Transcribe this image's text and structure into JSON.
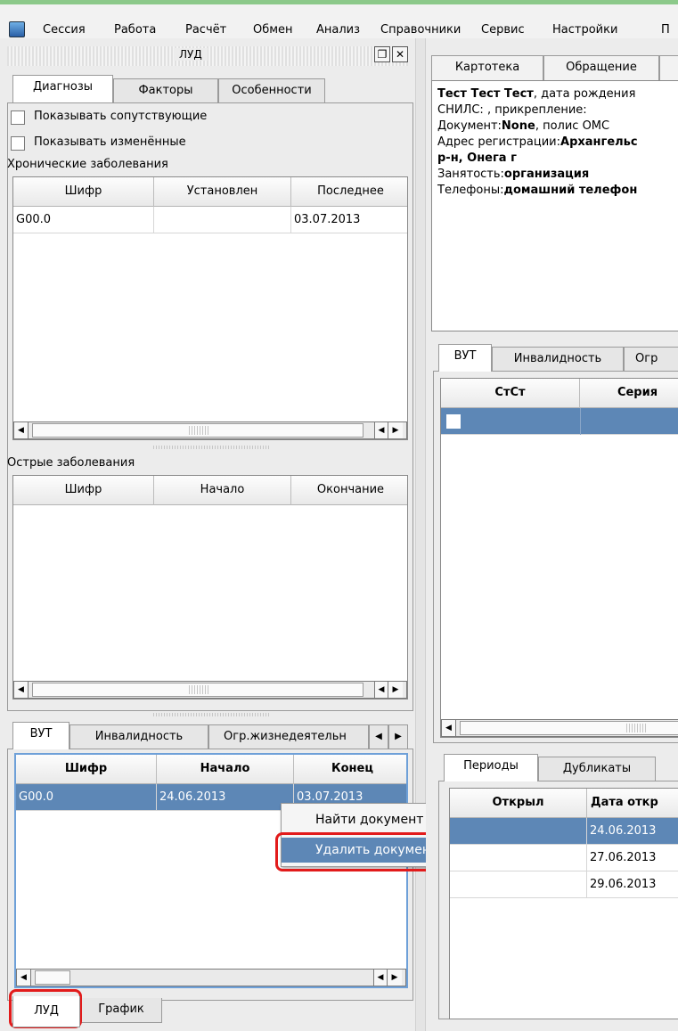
{
  "menu": [
    "Сессия",
    "Работа",
    "Расчёт",
    "Обмен",
    "Анализ",
    "Справочники",
    "Сервис",
    "Настройки",
    "П"
  ],
  "dock": {
    "title": "ЛУД",
    "float_icon": "float-icon",
    "close_icon": "close-icon"
  },
  "left_tabs": [
    "Диагнозы",
    "Факторы",
    "Особенности"
  ],
  "checkboxes": {
    "show_concomitant": "Показывать сопутствующие",
    "show_changed": "Показывать изменённые"
  },
  "chronic": {
    "title": "Хронические заболевания",
    "headers": [
      "Шифр",
      "Установлен",
      "Последнее"
    ],
    "rows": [
      [
        "G00.0",
        "",
        "03.07.2013"
      ]
    ]
  },
  "acute": {
    "title": "Острые заболевания",
    "headers": [
      "Шифр",
      "Начало",
      "Окончание"
    ]
  },
  "bottom_tabs": [
    "ВУТ",
    "Инвалидность",
    "Огр.жизнедеятельн"
  ],
  "vut_table": {
    "headers": [
      "Шифр",
      "Начало",
      "Конец"
    ],
    "rows": [
      [
        "G00.0",
        "24.06.2013",
        "03.07.2013"
      ]
    ]
  },
  "context_menu": {
    "find": "Найти документ",
    "delete": "Удалить документ"
  },
  "footer_tabs": [
    "ЛУД",
    "График"
  ],
  "right_tabs": [
    "Картотека",
    "Обращение"
  ],
  "patient": {
    "name": "Тест Тест Тест",
    "birth": ", дата рождения",
    "snils": "СНИЛС: , прикрепление:",
    "doc_label": "Документ:",
    "doc_value": "None",
    "doc_rest": ", полис ОМС",
    "addr_label": "Адрес регистрации:",
    "addr_value": "Архангельс",
    "addr_line2": "р-н, Онега г",
    "job_label": "Занятость:",
    "job_value": "организация",
    "phone_label": "Телефоны:",
    "phone_value": "домашний телефон"
  },
  "right_mid_tabs": [
    "ВУТ",
    "Инвалидность",
    "Огр"
  ],
  "right_mid_table": {
    "headers": [
      "СтСт",
      "Серия"
    ]
  },
  "period_tabs": [
    "Периоды",
    "Дубликаты"
  ],
  "periods_table": {
    "headers": [
      "Открыл",
      "Дата откр"
    ],
    "rows": [
      [
        "",
        "24.06.2013"
      ],
      [
        "",
        "27.06.2013"
      ],
      [
        "",
        "29.06.2013"
      ]
    ]
  }
}
